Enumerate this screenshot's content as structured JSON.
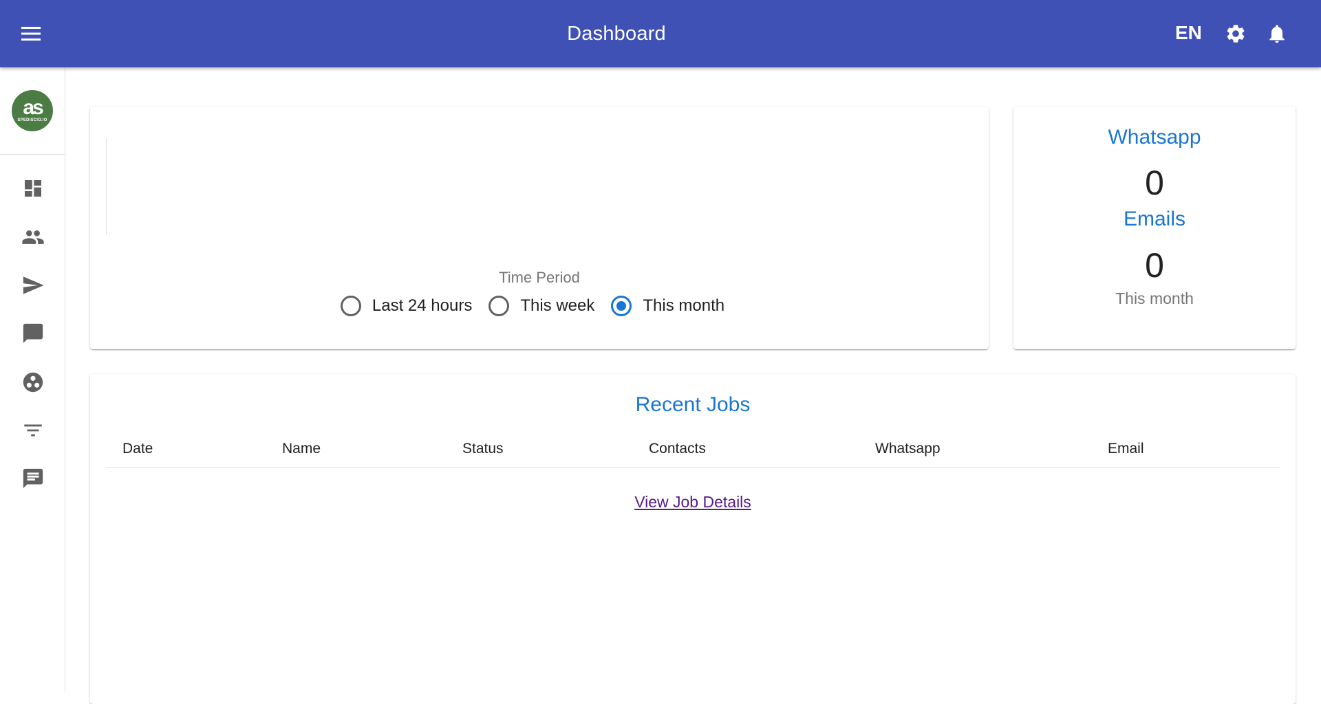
{
  "appbar": {
    "title": "Dashboard",
    "language": "EN"
  },
  "logo": {
    "text": "as",
    "subtext": "SPEDISCIO.IO",
    "color": "#4a7c44"
  },
  "sidebar": {
    "items": [
      {
        "icon": "dashboard-icon"
      },
      {
        "icon": "people-icon"
      },
      {
        "icon": "send-icon"
      },
      {
        "icon": "chat-bubble-icon"
      },
      {
        "icon": "groups-circle-icon"
      },
      {
        "icon": "filter-icon"
      },
      {
        "icon": "message-icon"
      }
    ]
  },
  "time_period": {
    "title": "Time Period",
    "options": [
      {
        "label": "Last 24 hours",
        "checked": false
      },
      {
        "label": "This week",
        "checked": false
      },
      {
        "label": "This month",
        "checked": true
      }
    ]
  },
  "stats": {
    "whatsapp_label": "Whatsapp",
    "whatsapp_value": "0",
    "emails_label": "Emails",
    "emails_value": "0",
    "period": "This month"
  },
  "recent_jobs": {
    "title": "Recent Jobs",
    "columns": [
      "Date",
      "Name",
      "Status",
      "Contacts",
      "Whatsapp",
      "Email"
    ],
    "view_details": "View Job Details"
  },
  "colors": {
    "appbar": "#3f51b5",
    "accent": "#1976d2",
    "link": "#551a8b"
  }
}
